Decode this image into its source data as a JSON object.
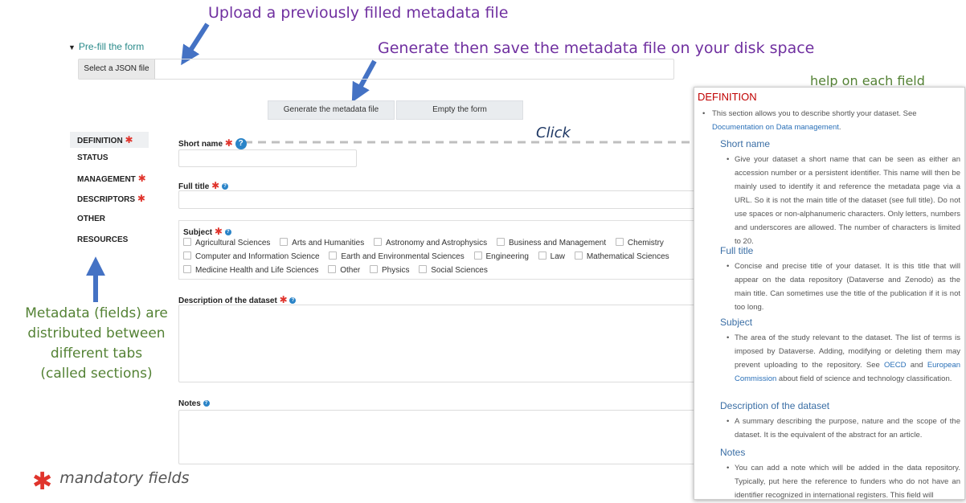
{
  "callouts": {
    "upload": "Upload a previously filled metadata file",
    "generate": "Generate then save the metadata file on your disk space",
    "help": "help on each field",
    "click": "Click",
    "metadata_lines": [
      "Metadata (fields) are",
      "distributed between",
      "different tabs",
      "(called sections)"
    ],
    "mandatory": "mandatory fields"
  },
  "prefill": {
    "toggle_label": "Pre-fill the form",
    "file_button": "Select a JSON file"
  },
  "actions": {
    "generate": "Generate the metadata file",
    "empty": "Empty the form"
  },
  "tabs": [
    {
      "label": "DEFINITION",
      "mandatory": true
    },
    {
      "label": "STATUS",
      "mandatory": false
    },
    {
      "label": "MANAGEMENT",
      "mandatory": true
    },
    {
      "label": "DESCRIPTORS",
      "mandatory": true
    },
    {
      "label": "OTHER",
      "mandatory": false
    },
    {
      "label": "RESOURCES",
      "mandatory": false
    }
  ],
  "fields": {
    "short_name": "Short name",
    "full_title": "Full title",
    "subject": "Subject",
    "description": "Description of the dataset",
    "notes": "Notes"
  },
  "subjects": {
    "row1": [
      "Agricultural Sciences",
      "Arts and Humanities",
      "Astronomy and Astrophysics",
      "Business and Management",
      "Chemistry"
    ],
    "row2": [
      "Computer and Information Science",
      "Earth and Environmental Sciences",
      "Engineering",
      "Law",
      "Mathematical Sciences"
    ],
    "row3": [
      "Medicine Health and Life Sciences",
      "Other",
      "Physics",
      "Social Sciences"
    ]
  },
  "help_panel": {
    "title": "DEFINITION",
    "intro": "This section allows you to describe shortly your dataset. See",
    "intro_link": "Documentation on Data management",
    "sections": {
      "short_name": {
        "heading": "Short name",
        "text": "Give your dataset a short name that can be seen as either an accession number or a persistent identifier. This name will then be mainly used to identify it and reference the metadata page via a URL. So it is not the main title of the dataset (see full title). Do not use spaces or non-alphanumeric characters. Only letters, numbers and underscores are allowed. The number of characters is limited to 20."
      },
      "full_title": {
        "heading": "Full title",
        "text": "Concise and precise title of your dataset. It is this title that will appear on the data repository (Dataverse and Zenodo) as the main title. Can sometimes use the title of the publication if it is not too long."
      },
      "subject": {
        "heading": "Subject",
        "text_before": "The area of the study relevant to the dataset. The list of terms is imposed by Dataverse. Adding, modifying or deleting them may prevent uploading to the repository. See",
        "link1": "OECD",
        "text_mid": "and",
        "link2": "European Commission",
        "text_after": "about field of science and technology classification."
      },
      "description": {
        "heading": "Description of the dataset",
        "text": "A summary describing the purpose, nature and the scope of the dataset. It is the equivalent of the abstract for an article."
      },
      "notes": {
        "heading": "Notes",
        "text": "You can add a note which will be added in the data repository. Typically, put here the reference to funders who do not have an identifier recognized in international registers. This field will"
      }
    }
  },
  "colors": {
    "callout_purple": "#7030a0",
    "callout_green": "#548235",
    "arrow_blue": "#4472c4",
    "mandatory_red": "#e0342c",
    "link_blue": "#2a70b8"
  },
  "icons": {
    "help": "help-circle-icon",
    "star": "asterisk-icon",
    "toggle": "triangle-down-icon"
  }
}
